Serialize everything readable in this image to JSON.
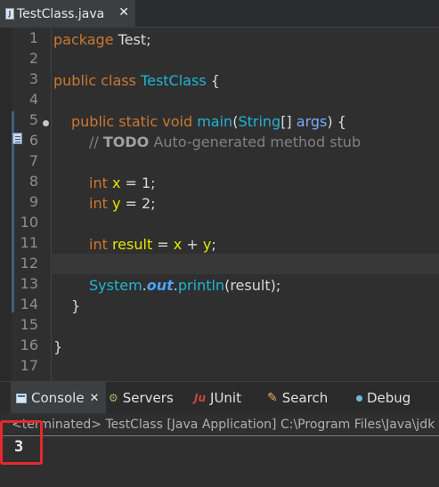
{
  "editor_tab": {
    "label": "TestClass.java",
    "icon": "java-file-icon",
    "close": "✕"
  },
  "line_numbers": [
    "1",
    "2",
    "3",
    "4",
    "5",
    "6",
    "7",
    "8",
    "9",
    "10",
    "11",
    "12",
    "13",
    "14",
    "15",
    "16",
    "17"
  ],
  "code": {
    "l1": {
      "kw": "package",
      "rest": " Test;"
    },
    "l3": {
      "kw": "public class",
      "name": "TestClass",
      "rest": " {"
    },
    "l5": {
      "kw": "public static void",
      "method": "main",
      "open": "(",
      "type": "String",
      "arr": "[] ",
      "param": "args",
      "close": ") {"
    },
    "l6": {
      "slashes": "// ",
      "todo": "TODO",
      "rest": " Auto-generated method stub"
    },
    "l8": {
      "kw": "int",
      "var": "x",
      "rest": " = 1;"
    },
    "l9": {
      "kw": "int",
      "var": "y",
      "rest": " = 2;"
    },
    "l11": {
      "kw": "int",
      "var": "result",
      "eq": " = ",
      "a": "x",
      "plus": " + ",
      "b": "y",
      "semi": ";"
    },
    "l13": {
      "sys": "System",
      "dot1": ".",
      "out": "out",
      "dot2": ".",
      "call": "println",
      "args": "(result);"
    },
    "l14": {
      "brace": "}"
    },
    "l16": {
      "brace": "}"
    }
  },
  "panel_tabs": {
    "console": "Console",
    "servers": "Servers",
    "junit": "JUnit",
    "search": "Search",
    "debug": "Debug",
    "close": "✕"
  },
  "console": {
    "header": "<terminated> TestClass [Java Application] C:\\Program Files\\Java\\jdk",
    "output": "3"
  },
  "colors": {
    "keyword": "#cc7832",
    "type": "#1eb5d3",
    "variable": "#e6e600",
    "highlight_box": "#e8282e"
  }
}
